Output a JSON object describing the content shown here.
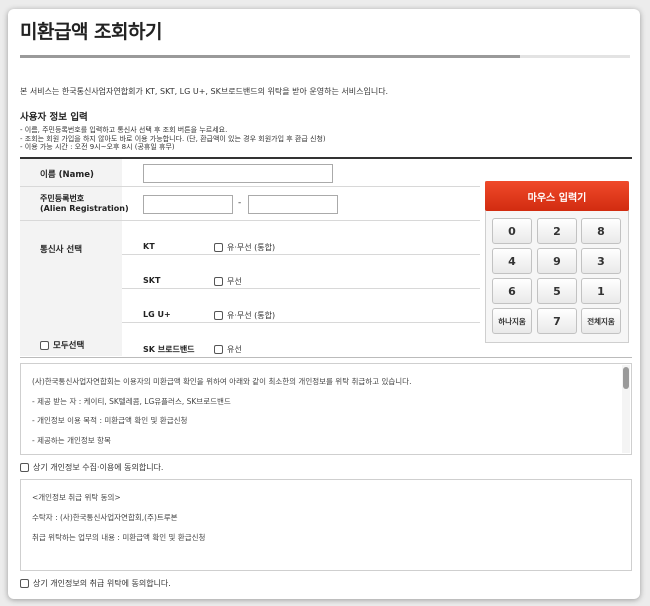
{
  "page": {
    "title": "미환급액 조회하기",
    "service_desc": "본 서비스는 한국통신사업자연합회가 KT, SKT, LG U+, SK브로드밴드의 위탁을 받아 운영하는 서비스입니다.",
    "section_title": "사용자 정보 입력",
    "notes": [
      "- 이름, 주민등록번호를 입력하고 통신사 선택 후 조회 버튼을 누르세요.",
      "- 조회는 회원 가입을 하지 않아도 바로 이용 가능합니다. (단, 환급액이 있는 경우 회원가입 후 환급 신청)",
      "- 이용 가능 시간 : 오전 9시~오후 8시 (공휴일 휴무)"
    ]
  },
  "form": {
    "name_label": "이름 (Name)",
    "name_value": "",
    "reg_label_1": "주민등록번호",
    "reg_label_2": "(Alien Registration)",
    "reg_front_value": "",
    "reg_back_value": "",
    "reg_separator": "-",
    "carrier_label": "통신사 선택",
    "select_all_label": "모두선택",
    "carriers": [
      {
        "name": "KT",
        "option": "유·무선 (통합)"
      },
      {
        "name": "SKT",
        "option": "무선"
      },
      {
        "name": "LG U+",
        "option": "유·무선 (통합)"
      },
      {
        "name": "SK 브로드밴드",
        "option": "유선"
      }
    ]
  },
  "mouse_input": {
    "title": "마우스 입력기",
    "keys": [
      "0",
      "2",
      "8",
      "4",
      "9",
      "3",
      "6",
      "5",
      "1",
      "하나지움",
      "7",
      "전체지움"
    ]
  },
  "privacy": {
    "intro": "(사)한국통신사업자연합회는 이용자의 미환급액 확인을 위하여 아래와 같이 최소한의 개인정보를 위탁 취급하고 있습니다.",
    "recipients": "- 제공 받는 자 : 케이티, SK텔레콤, LG유플러스, SK브로드밴드",
    "purpose": "- 개인정보 이용 목적 : 미환급액 확인 및 환급신청",
    "items": "- 제공하는 개인정보 항목",
    "agree_label": "상기 개인정보 수집·이용에 동의합니다."
  },
  "consignment": {
    "heading": "<개인정보 취급 위탁 동의>",
    "trustee": "수탁자 : (사)한국통신사업자연합회,(주)트루본",
    "task": "취급 위탁하는 업무의 내용 : 미환급액 확인 및 환급신청",
    "agree_label": "상기 개인정보의 취급 위탁에 동의합니다."
  }
}
